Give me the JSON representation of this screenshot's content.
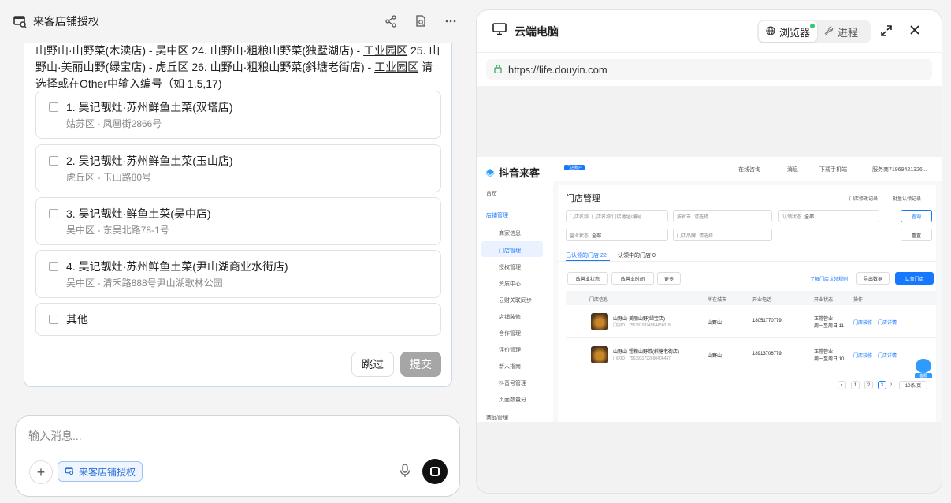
{
  "left": {
    "header": {
      "title": "来客店铺授权"
    },
    "intro": {
      "part1": "山野山·山野菜(木渎店) - 吴中区 24. 山野山·粗粮山野菜(独墅湖店) - ",
      "u1": "工业园区",
      "part2": " 25. 山野山·美丽山野(绿宝店) - 虎丘区 26. 山野山·粗粮山野菜(斜塘老街店) - ",
      "u2": "工业园区",
      "part3": " 请选择或在Other中输入编号（如 1,5,17)"
    },
    "options": [
      {
        "title": "1. 吴记靓灶·苏州鲜鱼土菜(双塔店)",
        "sub": "姑苏区 - 凤凰街2866号"
      },
      {
        "title": "2. 吴记靓灶·苏州鲜鱼土菜(玉山店)",
        "sub": "虎丘区 - 玉山路80号"
      },
      {
        "title": "3. 吴记靓灶·鲜鱼土菜(吴中店)",
        "sub": "吴中区 - 东吴北路78-1号"
      },
      {
        "title": "4. 吴记靓灶·苏州鲜鱼土菜(尹山湖商业水街店)",
        "sub": "吴中区 - 清禾路888号尹山湖歌林公园"
      },
      {
        "title": "其他",
        "sub": ""
      }
    ],
    "skip_label": "跳过",
    "submit_label": "提交",
    "composer": {
      "placeholder": "输入消息...",
      "chip_label": "来客店铺授权"
    }
  },
  "right": {
    "title": "云端电脑",
    "tab_browser": "浏览器",
    "tab_process": "进程",
    "url": "https://life.douyin.com",
    "page": {
      "brand": "抖音来客",
      "top_tag": "门店账户",
      "top_links": [
        "在线咨询",
        "消息",
        "下载手机端"
      ],
      "account": "服务商71969421326...",
      "nav": [
        "首页",
        "店铺管理",
        "商家信息",
        "门店管理",
        "授权管理",
        "资质中心",
        "云财关联同步",
        "店铺装修",
        "合作管理",
        "评价管理",
        "新人指南",
        "抖音号管理",
        "页面数量分",
        "商品管理"
      ],
      "heading": "门店管理",
      "head_links": [
        "门店修改记录",
        "批量认领记录"
      ],
      "filters": {
        "store_name_label": "门店名称",
        "store_name_ph": "门店名称/门店地址/编号",
        "province_label": "按省市",
        "province_ph": "请选择",
        "auth_label": "认领状态",
        "auth_val": "全部",
        "biz_label": "营业状态",
        "biz_val": "全部",
        "brand_label": "门店品牌",
        "brand_ph": "请选择",
        "query": "查询",
        "reset": "重置"
      },
      "subtabs": [
        "已认领的门店 22",
        "认领中的门店 0"
      ],
      "bulk_buttons": [
        "改营业状态",
        "改营业时间",
        "更多"
      ],
      "right_actions": [
        "了解门店认领规则",
        "导出数据",
        "认领门店"
      ],
      "table_headers": [
        "门店信息",
        "所在城市",
        "开业电话",
        "开业状态",
        "操作"
      ],
      "rows": [
        {
          "name": "山野山·美丽山野(绿宝店)",
          "id": "门店ID：7563810874964458018",
          "city": "山野山",
          "phone": "18051770779",
          "status1": "正常营业",
          "status2": "周一至周日 11",
          "ops": [
            "门店装修",
            "门店详情"
          ]
        },
        {
          "name": "山野山·粗粮山野菜(斜塘老街店)",
          "id": "门店ID：7563931722690406437",
          "city": "山野山",
          "phone": "18913706779",
          "status1": "正常营业",
          "status2": "周一至周日 10",
          "ops": [
            "门店装修",
            "门店详情"
          ]
        }
      ],
      "pagination": [
        "1",
        "2",
        "3"
      ],
      "page_size": "10条/页",
      "helper": "客服"
    }
  }
}
